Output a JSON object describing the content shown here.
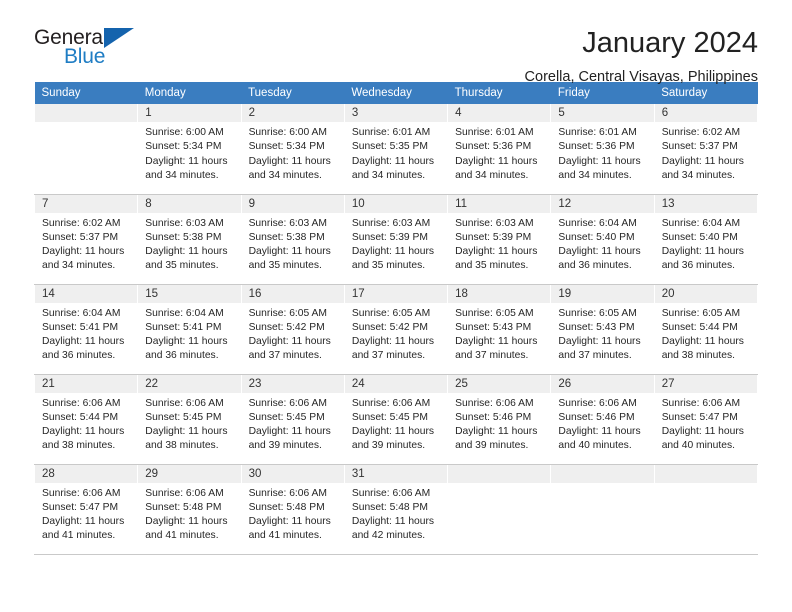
{
  "brand": {
    "name_top": "General",
    "name_bottom": "Blue",
    "accent_color": "#1463ad",
    "blue_text_color": "#1f7dc4"
  },
  "header": {
    "title": "January 2024",
    "subtitle": "Corella, Central Visayas, Philippines"
  },
  "calendar": {
    "header_bg": "#3a7dc0",
    "daynum_bg": "#efefef",
    "weekdays": [
      "Sunday",
      "Monday",
      "Tuesday",
      "Wednesday",
      "Thursday",
      "Friday",
      "Saturday"
    ],
    "weeks": [
      [
        {
          "day": "",
          "sunrise": "",
          "sunset": "",
          "daylight1": "",
          "daylight2": "",
          "blank": true
        },
        {
          "day": "1",
          "sunrise": "Sunrise: 6:00 AM",
          "sunset": "Sunset: 5:34 PM",
          "daylight1": "Daylight: 11 hours",
          "daylight2": "and 34 minutes.",
          "blank": false
        },
        {
          "day": "2",
          "sunrise": "Sunrise: 6:00 AM",
          "sunset": "Sunset: 5:34 PM",
          "daylight1": "Daylight: 11 hours",
          "daylight2": "and 34 minutes.",
          "blank": false
        },
        {
          "day": "3",
          "sunrise": "Sunrise: 6:01 AM",
          "sunset": "Sunset: 5:35 PM",
          "daylight1": "Daylight: 11 hours",
          "daylight2": "and 34 minutes.",
          "blank": false
        },
        {
          "day": "4",
          "sunrise": "Sunrise: 6:01 AM",
          "sunset": "Sunset: 5:36 PM",
          "daylight1": "Daylight: 11 hours",
          "daylight2": "and 34 minutes.",
          "blank": false
        },
        {
          "day": "5",
          "sunrise": "Sunrise: 6:01 AM",
          "sunset": "Sunset: 5:36 PM",
          "daylight1": "Daylight: 11 hours",
          "daylight2": "and 34 minutes.",
          "blank": false
        },
        {
          "day": "6",
          "sunrise": "Sunrise: 6:02 AM",
          "sunset": "Sunset: 5:37 PM",
          "daylight1": "Daylight: 11 hours",
          "daylight2": "and 34 minutes.",
          "blank": false
        }
      ],
      [
        {
          "day": "7",
          "sunrise": "Sunrise: 6:02 AM",
          "sunset": "Sunset: 5:37 PM",
          "daylight1": "Daylight: 11 hours",
          "daylight2": "and 34 minutes.",
          "blank": false
        },
        {
          "day": "8",
          "sunrise": "Sunrise: 6:03 AM",
          "sunset": "Sunset: 5:38 PM",
          "daylight1": "Daylight: 11 hours",
          "daylight2": "and 35 minutes.",
          "blank": false
        },
        {
          "day": "9",
          "sunrise": "Sunrise: 6:03 AM",
          "sunset": "Sunset: 5:38 PM",
          "daylight1": "Daylight: 11 hours",
          "daylight2": "and 35 minutes.",
          "blank": false
        },
        {
          "day": "10",
          "sunrise": "Sunrise: 6:03 AM",
          "sunset": "Sunset: 5:39 PM",
          "daylight1": "Daylight: 11 hours",
          "daylight2": "and 35 minutes.",
          "blank": false
        },
        {
          "day": "11",
          "sunrise": "Sunrise: 6:03 AM",
          "sunset": "Sunset: 5:39 PM",
          "daylight1": "Daylight: 11 hours",
          "daylight2": "and 35 minutes.",
          "blank": false
        },
        {
          "day": "12",
          "sunrise": "Sunrise: 6:04 AM",
          "sunset": "Sunset: 5:40 PM",
          "daylight1": "Daylight: 11 hours",
          "daylight2": "and 36 minutes.",
          "blank": false
        },
        {
          "day": "13",
          "sunrise": "Sunrise: 6:04 AM",
          "sunset": "Sunset: 5:40 PM",
          "daylight1": "Daylight: 11 hours",
          "daylight2": "and 36 minutes.",
          "blank": false
        }
      ],
      [
        {
          "day": "14",
          "sunrise": "Sunrise: 6:04 AM",
          "sunset": "Sunset: 5:41 PM",
          "daylight1": "Daylight: 11 hours",
          "daylight2": "and 36 minutes.",
          "blank": false
        },
        {
          "day": "15",
          "sunrise": "Sunrise: 6:04 AM",
          "sunset": "Sunset: 5:41 PM",
          "daylight1": "Daylight: 11 hours",
          "daylight2": "and 36 minutes.",
          "blank": false
        },
        {
          "day": "16",
          "sunrise": "Sunrise: 6:05 AM",
          "sunset": "Sunset: 5:42 PM",
          "daylight1": "Daylight: 11 hours",
          "daylight2": "and 37 minutes.",
          "blank": false
        },
        {
          "day": "17",
          "sunrise": "Sunrise: 6:05 AM",
          "sunset": "Sunset: 5:42 PM",
          "daylight1": "Daylight: 11 hours",
          "daylight2": "and 37 minutes.",
          "blank": false
        },
        {
          "day": "18",
          "sunrise": "Sunrise: 6:05 AM",
          "sunset": "Sunset: 5:43 PM",
          "daylight1": "Daylight: 11 hours",
          "daylight2": "and 37 minutes.",
          "blank": false
        },
        {
          "day": "19",
          "sunrise": "Sunrise: 6:05 AM",
          "sunset": "Sunset: 5:43 PM",
          "daylight1": "Daylight: 11 hours",
          "daylight2": "and 37 minutes.",
          "blank": false
        },
        {
          "day": "20",
          "sunrise": "Sunrise: 6:05 AM",
          "sunset": "Sunset: 5:44 PM",
          "daylight1": "Daylight: 11 hours",
          "daylight2": "and 38 minutes.",
          "blank": false
        }
      ],
      [
        {
          "day": "21",
          "sunrise": "Sunrise: 6:06 AM",
          "sunset": "Sunset: 5:44 PM",
          "daylight1": "Daylight: 11 hours",
          "daylight2": "and 38 minutes.",
          "blank": false
        },
        {
          "day": "22",
          "sunrise": "Sunrise: 6:06 AM",
          "sunset": "Sunset: 5:45 PM",
          "daylight1": "Daylight: 11 hours",
          "daylight2": "and 38 minutes.",
          "blank": false
        },
        {
          "day": "23",
          "sunrise": "Sunrise: 6:06 AM",
          "sunset": "Sunset: 5:45 PM",
          "daylight1": "Daylight: 11 hours",
          "daylight2": "and 39 minutes.",
          "blank": false
        },
        {
          "day": "24",
          "sunrise": "Sunrise: 6:06 AM",
          "sunset": "Sunset: 5:45 PM",
          "daylight1": "Daylight: 11 hours",
          "daylight2": "and 39 minutes.",
          "blank": false
        },
        {
          "day": "25",
          "sunrise": "Sunrise: 6:06 AM",
          "sunset": "Sunset: 5:46 PM",
          "daylight1": "Daylight: 11 hours",
          "daylight2": "and 39 minutes.",
          "blank": false
        },
        {
          "day": "26",
          "sunrise": "Sunrise: 6:06 AM",
          "sunset": "Sunset: 5:46 PM",
          "daylight1": "Daylight: 11 hours",
          "daylight2": "and 40 minutes.",
          "blank": false
        },
        {
          "day": "27",
          "sunrise": "Sunrise: 6:06 AM",
          "sunset": "Sunset: 5:47 PM",
          "daylight1": "Daylight: 11 hours",
          "daylight2": "and 40 minutes.",
          "blank": false
        }
      ],
      [
        {
          "day": "28",
          "sunrise": "Sunrise: 6:06 AM",
          "sunset": "Sunset: 5:47 PM",
          "daylight1": "Daylight: 11 hours",
          "daylight2": "and 41 minutes.",
          "blank": false
        },
        {
          "day": "29",
          "sunrise": "Sunrise: 6:06 AM",
          "sunset": "Sunset: 5:48 PM",
          "daylight1": "Daylight: 11 hours",
          "daylight2": "and 41 minutes.",
          "blank": false
        },
        {
          "day": "30",
          "sunrise": "Sunrise: 6:06 AM",
          "sunset": "Sunset: 5:48 PM",
          "daylight1": "Daylight: 11 hours",
          "daylight2": "and 41 minutes.",
          "blank": false
        },
        {
          "day": "31",
          "sunrise": "Sunrise: 6:06 AM",
          "sunset": "Sunset: 5:48 PM",
          "daylight1": "Daylight: 11 hours",
          "daylight2": "and 42 minutes.",
          "blank": false
        },
        {
          "day": "",
          "sunrise": "",
          "sunset": "",
          "daylight1": "",
          "daylight2": "",
          "blank": true
        },
        {
          "day": "",
          "sunrise": "",
          "sunset": "",
          "daylight1": "",
          "daylight2": "",
          "blank": true
        },
        {
          "day": "",
          "sunrise": "",
          "sunset": "",
          "daylight1": "",
          "daylight2": "",
          "blank": true
        }
      ]
    ]
  }
}
